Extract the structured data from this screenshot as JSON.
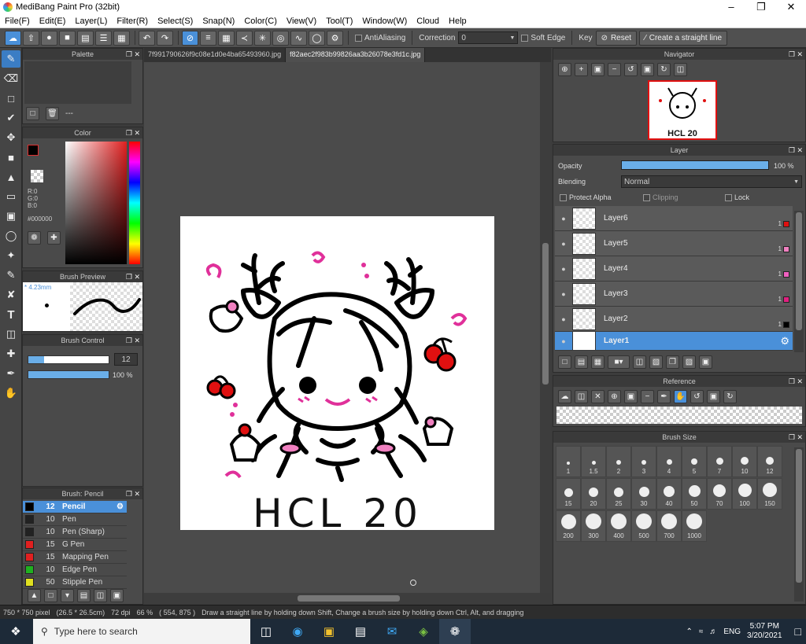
{
  "window": {
    "title": "MediBang Paint Pro (32bit)"
  },
  "menu": [
    "File(F)",
    "Edit(E)",
    "Layer(L)",
    "Filter(R)",
    "Select(S)",
    "Snap(N)",
    "Color(C)",
    "View(V)",
    "Tool(T)",
    "Window(W)",
    "Cloud",
    "Help"
  ],
  "toolbar": {
    "antialiasing_label": "AntiAliasing",
    "correction_label": "Correction",
    "correction_value": "0",
    "soft_edge_label": "Soft Edge",
    "key_label": "Key",
    "reset_label": "Reset",
    "straight_line_label": "Create a straight line"
  },
  "palette": {
    "title": "Palette",
    "value": "---"
  },
  "color": {
    "title": "Color",
    "r": "R:0",
    "g": "G:0",
    "b": "B:0",
    "hex": "#000000"
  },
  "brush_preview": {
    "title": "Brush Preview",
    "size": "* 4.23mm"
  },
  "brush_control": {
    "title": "Brush Control",
    "size_value": "12",
    "opacity_value": "100 %",
    "size_fraction": 0.2,
    "opacity_fraction": 1.0
  },
  "brush_list": {
    "title": "Brush: Pencil",
    "items": [
      {
        "size": "12",
        "name": "Pencil",
        "color": "#000000",
        "active": true
      },
      {
        "size": "10",
        "name": "Pen",
        "color": "#222222"
      },
      {
        "size": "10",
        "name": "Pen (Sharp)",
        "color": "#222222"
      },
      {
        "size": "15",
        "name": "G Pen",
        "color": "#e02020"
      },
      {
        "size": "15",
        "name": "Mapping Pen",
        "color": "#e02020"
      },
      {
        "size": "10",
        "name": "Edge Pen",
        "color": "#20b020"
      },
      {
        "size": "50",
        "name": "Stipple Pen",
        "color": "#e0e020"
      }
    ]
  },
  "tabs": [
    {
      "label": "7f991790626f9c08e1d0e4ba65493960.jpg",
      "active": false
    },
    {
      "label": "f82aec2f983b99826aa3b26078e3fd1c.jpg",
      "active": true
    }
  ],
  "artwork": {
    "caption": "HCL 20"
  },
  "navigator": {
    "title": "Navigator"
  },
  "layer_panel": {
    "title": "Layer",
    "opacity_label": "Opacity",
    "opacity_value": "100 %",
    "opacity_fraction": 1.0,
    "blending_label": "Blending",
    "blending_value": "Normal",
    "protect_alpha_label": "Protect Alpha",
    "clipping_label": "Clipping",
    "lock_label": "Lock",
    "layers": [
      {
        "name": "Layer6",
        "num": "1",
        "color": "#e01010"
      },
      {
        "name": "Layer5",
        "num": "1",
        "color": "#f080c0"
      },
      {
        "name": "Layer4",
        "num": "1",
        "color": "#f060c0"
      },
      {
        "name": "Layer3",
        "num": "1",
        "color": "#e02080"
      },
      {
        "name": "Layer2",
        "num": "1",
        "color": "#000000"
      },
      {
        "name": "Layer1",
        "num": "",
        "color": "",
        "active": true
      }
    ]
  },
  "reference": {
    "title": "Reference"
  },
  "brush_size": {
    "title": "Brush Size",
    "sizes": [
      "1",
      "1.5",
      "2",
      "3",
      "4",
      "5",
      "7",
      "10",
      "12",
      "15",
      "20",
      "25",
      "30",
      "40",
      "50",
      "70",
      "100",
      "150",
      "200",
      "300",
      "400",
      "500",
      "700",
      "1000"
    ]
  },
  "status": {
    "dimensions": "750 * 750 pixel",
    "cm": "(26.5 * 26.5cm)",
    "dpi": "72 dpi",
    "zoom": "66 %",
    "coords": "( 554, 875 )",
    "hint": "Draw a straight line by holding down Shift, Change a brush size by holding down Ctrl, Alt, and dragging"
  },
  "taskbar": {
    "search_placeholder": "Type here to search",
    "lang": "ENG",
    "time": "5:07 PM",
    "date": "3/20/2021"
  }
}
